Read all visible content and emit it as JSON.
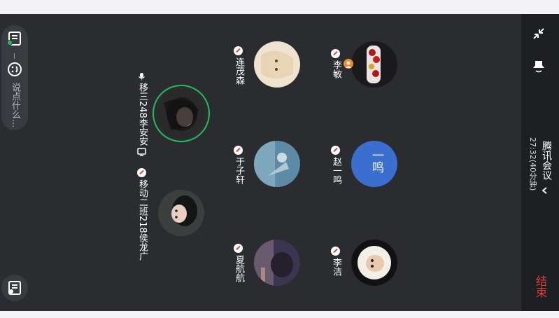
{
  "meeting": {
    "app_title": "腾讯会议",
    "duration": "27:32(40分钟)",
    "end_label": "结束"
  },
  "chat": {
    "placeholder": "说点什么..."
  },
  "participants": [
    {
      "name": "李敏",
      "muted": true,
      "host": true
    },
    {
      "name": "赵一鸣",
      "muted": true,
      "avatar_text": "一鸣"
    },
    {
      "name": "李洁",
      "muted": true
    },
    {
      "name": "连茂森",
      "muted": true
    },
    {
      "name": "于子轩",
      "muted": true
    },
    {
      "name": "夏航航",
      "muted": true
    },
    {
      "name": "移三248李安安",
      "muted": false,
      "speaking": true
    },
    {
      "name": "移动二班218侯龙广",
      "muted": true
    }
  ],
  "colors": {
    "stage": "#2b2c30",
    "right_bar": "#1e1f22",
    "end_red": "#e0413a",
    "speaking_ring": "#1fbf5b",
    "initials_bg": "#3a6fd0"
  }
}
